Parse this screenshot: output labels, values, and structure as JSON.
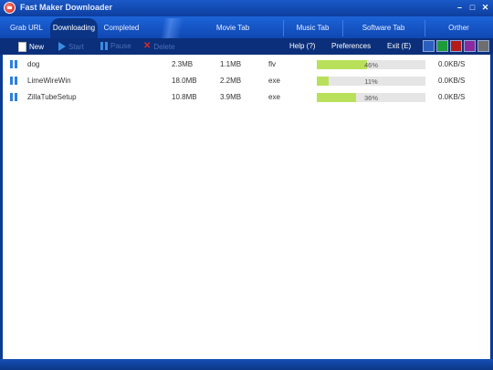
{
  "window": {
    "title": "Fast Maker Downloader"
  },
  "window_controls": {
    "minimize": "–",
    "maximize": "□",
    "close": "✕"
  },
  "tabs": {
    "grab_url": "Grab URL",
    "downloading": "Downloading",
    "completed": "Completed",
    "movie": "Movie Tab",
    "music": "Music Tab",
    "software": "Software Tab",
    "other": "Orther"
  },
  "toolbar": {
    "new": "New",
    "start": "Start",
    "pause": "Pause",
    "delete": "Delete",
    "help": "Help (?)",
    "preferences": "Preferences",
    "exit": "Exit (E)"
  },
  "skins": [
    "#2a5fc0",
    "#1f9c3a",
    "#b41c1c",
    "#8a2a9e",
    "#6e6e6e"
  ],
  "downloads": [
    {
      "name": "dog",
      "size": "2.3MB",
      "downloaded": "1.1MB",
      "type": "flv",
      "progress_pct": 46,
      "progress_label": "46%",
      "speed": "0.0KB/S"
    },
    {
      "name": "LimeWireWin",
      "size": "18.0MB",
      "downloaded": "2.2MB",
      "type": "exe",
      "progress_pct": 11,
      "progress_label": "11%",
      "speed": "0.0KB/S"
    },
    {
      "name": "ZillaTubeSetup",
      "size": "10.8MB",
      "downloaded": "3.9MB",
      "type": "exe",
      "progress_pct": 36,
      "progress_label": "36%",
      "speed": "0.0KB/S"
    }
  ]
}
